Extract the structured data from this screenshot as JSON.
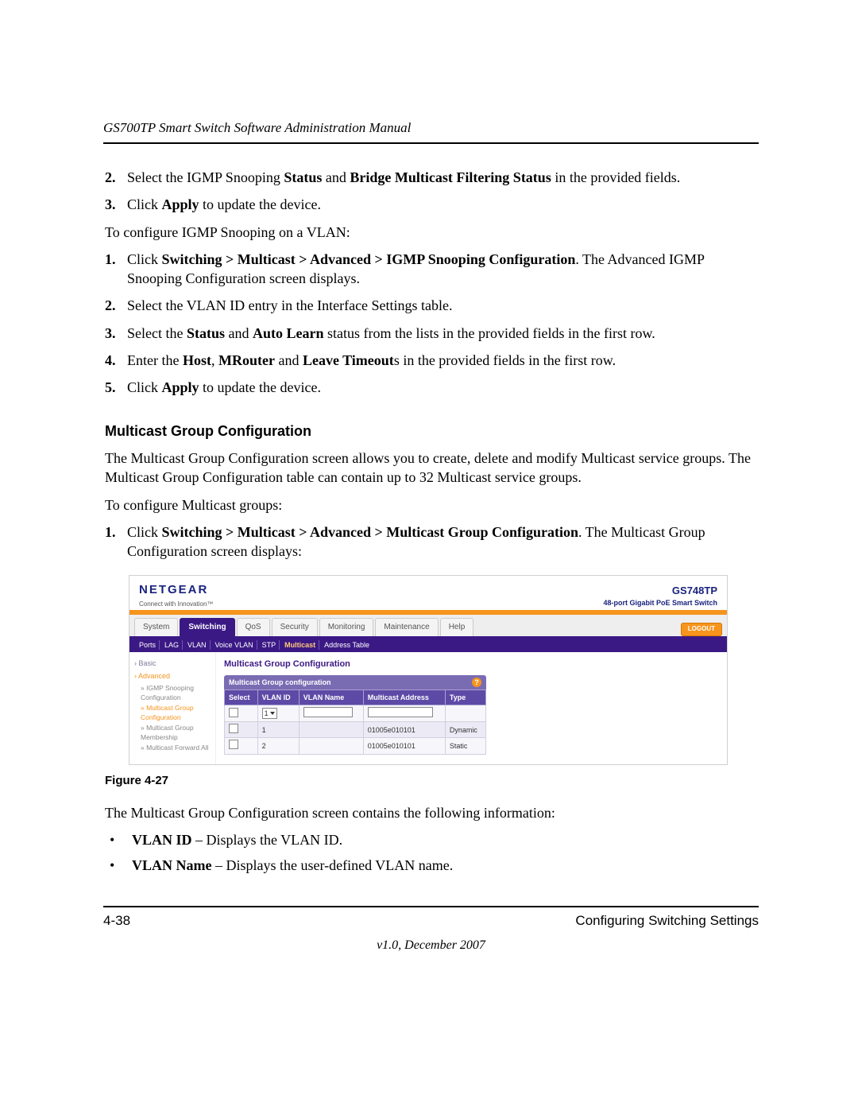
{
  "header": {
    "running": "GS700TP Smart Switch Software Administration Manual"
  },
  "top_steps": [
    {
      "num": "2.",
      "pre": "Select the IGMP Snooping ",
      "b1": "Status",
      "mid": " and ",
      "b2": "Bridge Multicast Filtering Status",
      "post": " in the provided fields."
    },
    {
      "num": "3.",
      "pre": "Click ",
      "b1": "Apply",
      "mid": "",
      "b2": "",
      "post": " to update the device."
    }
  ],
  "cfg_intro": "To configure IGMP Snooping on a VLAN:",
  "vlan_steps": [
    {
      "num": "1.",
      "pre": "Click ",
      "b1": "Switching > Multicast > Advanced > IGMP Snooping Configuration",
      "mid": ". The Advanced IGMP Snooping Configuration screen displays.",
      "b2": "",
      "post": ""
    },
    {
      "num": "2.",
      "pre": "Select the VLAN ID entry in the Interface Settings table.",
      "b1": "",
      "mid": "",
      "b2": "",
      "post": ""
    },
    {
      "num": "3.",
      "pre": "Select the ",
      "b1": "Status",
      "mid": " and ",
      "b2": "Auto Learn",
      "post": " status from the lists in the provided fields in the first row."
    },
    {
      "num": "4.",
      "pre": "Enter the ",
      "b1": "Host",
      "mid": ", ",
      "b2": "MRouter",
      "post2_pre": " and ",
      "b3": "Leave Timeout",
      "post": "s in the provided fields in the first row."
    },
    {
      "num": "5.",
      "pre": "Click ",
      "b1": "Apply",
      "mid": "",
      "b2": "",
      "post": " to update the device."
    }
  ],
  "section_title": "Multicast Group Configuration",
  "section_para": "The Multicast Group Configuration screen allows you to create, delete and modify Multicast service groups. The Multicast Group Configuration table can contain up to 32 Multicast service groups.",
  "mg_intro": "To configure Multicast groups:",
  "mg_step": {
    "num": "1.",
    "pre": "Click ",
    "b1": "Switching > Multicast > Advanced > Multicast Group Configuration",
    "post": ". The Multicast Group Configuration screen displays:"
  },
  "figure_label": "Figure 4-27",
  "after_fig": "The Multicast Group Configuration screen contains the following information:",
  "bullets": [
    {
      "b": "VLAN ID",
      "t": " – Displays the VLAN ID."
    },
    {
      "b": "VLAN Name",
      "t": " – Displays the user-defined VLAN name."
    }
  ],
  "footer": {
    "left": "4-38",
    "right": "Configuring Switching Settings",
    "center": "v1.0, December 2007"
  },
  "screenshot": {
    "brand": "NETGEAR",
    "brand_tag": "Connect with Innovation™",
    "product_model": "GS748TP",
    "product_desc": "48-port Gigabit PoE Smart Switch",
    "tabs": [
      "System",
      "Switching",
      "QoS",
      "Security",
      "Monitoring",
      "Maintenance",
      "Help"
    ],
    "active_tab_index": 1,
    "logout": "LOGOUT",
    "subnav": [
      "Ports",
      "LAG",
      "VLAN",
      "Voice VLAN",
      "STP",
      "Multicast",
      "Address Table"
    ],
    "subnav_active_index": 5,
    "sidebar": {
      "groups": [
        {
          "label": "Basic",
          "active": false,
          "subs": []
        },
        {
          "label": "Advanced",
          "active": true,
          "subs": [
            {
              "label": "IGMP Snooping Configuration",
              "active": false
            },
            {
              "label": "Multicast Group Configuration",
              "active": true
            },
            {
              "label": "Multicast Group Membership",
              "active": false
            },
            {
              "label": "Multicast Forward All",
              "active": false
            }
          ]
        }
      ]
    },
    "panel_title": "Multicast Group Configuration",
    "box_title": "Multicast Group configuration",
    "columns": [
      "Select",
      "VLAN ID",
      "VLAN Name",
      "Multicast Address",
      "Type"
    ],
    "editor_row": {
      "vlan_id_selected": "1"
    },
    "rows": [
      {
        "vlan_id": "1",
        "vlan_name": "",
        "mcast": "01005e010101",
        "type": "Dynamic"
      },
      {
        "vlan_id": "2",
        "vlan_name": "",
        "mcast": "01005e010101",
        "type": "Static"
      }
    ]
  }
}
